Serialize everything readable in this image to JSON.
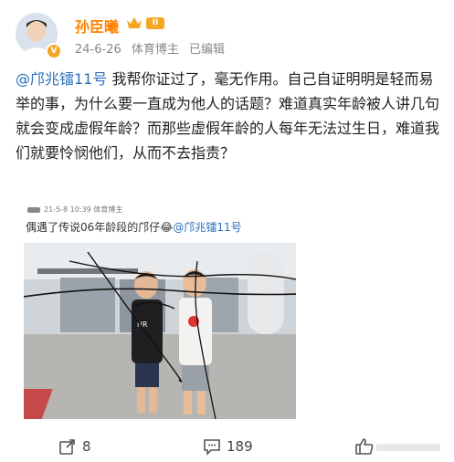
{
  "author": {
    "name": "孙臣曦",
    "level": "II",
    "date": "24-6-26",
    "tag": "体育博主",
    "edited": "已编辑"
  },
  "post": {
    "mention": "@邝兆镭11号",
    "text": " 我帮你证过了，毫无作用。自己自证明明是轻而易举的事，为什么要一直成为他人的话题？难道真实年龄被人讲几句就会变成虚假年龄？而那些虚假年龄的人每年无法过生日，难道我们就要怜悯他们，从而不去指责？"
  },
  "repost": {
    "date": "21-5-8 10:39",
    "tag": "体育博主",
    "text": "偶遇了传说06年龄段的邝仔",
    "emoji": "😂",
    "mention": "@邝兆镭11号",
    "photo_sign": "NR"
  },
  "footer": {
    "reposts": "8",
    "comments": "189"
  },
  "colors": {
    "username": "#ff8200",
    "mention": "#2c6fbb",
    "badge": "#f5a623"
  },
  "icons": [
    "verified-badge-icon",
    "crown-icon",
    "share-icon",
    "comment-icon",
    "like-icon"
  ]
}
